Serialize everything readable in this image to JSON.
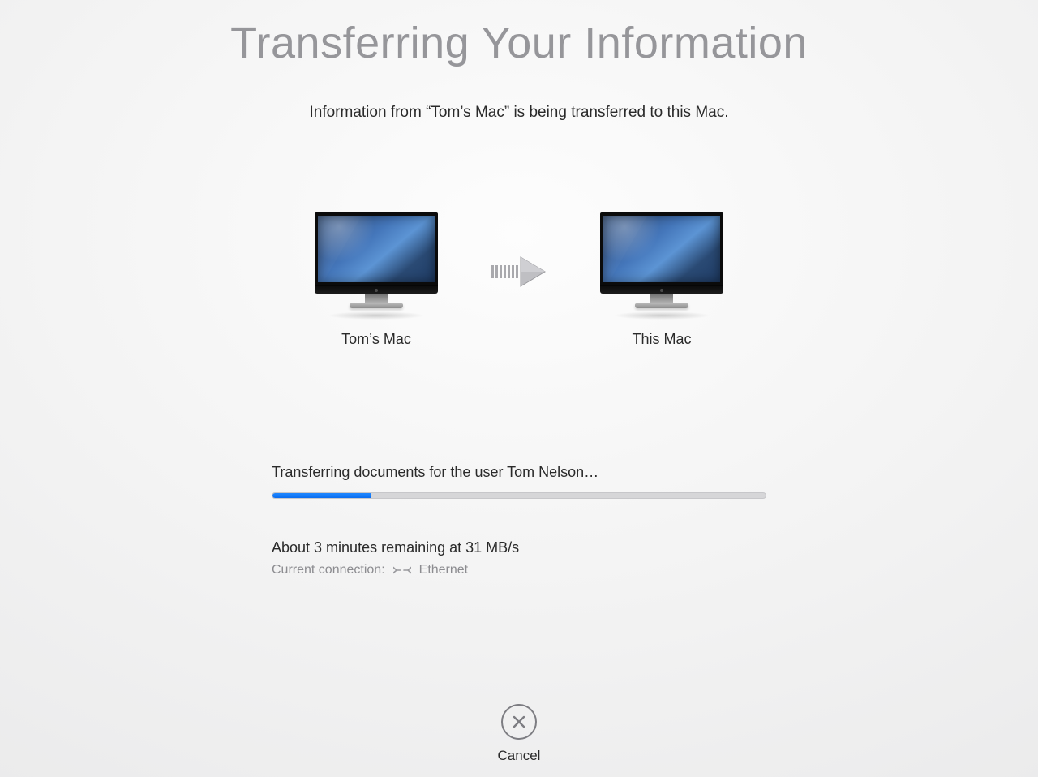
{
  "title": "Transferring Your Information",
  "subtitle": "Information from “Tom’s Mac” is being transferred to this Mac.",
  "devices": {
    "source_label": "Tom’s Mac",
    "destination_label": "This Mac"
  },
  "progress": {
    "status_text": "Transferring documents for the user Tom Nelson…",
    "percent": 20,
    "eta_text": "About 3 minutes remaining at 31 MB/s",
    "connection_label": "Current connection:",
    "connection_type": "Ethernet"
  },
  "cancel": {
    "label": "Cancel"
  },
  "colors": {
    "accent": "#0a6ef0"
  }
}
